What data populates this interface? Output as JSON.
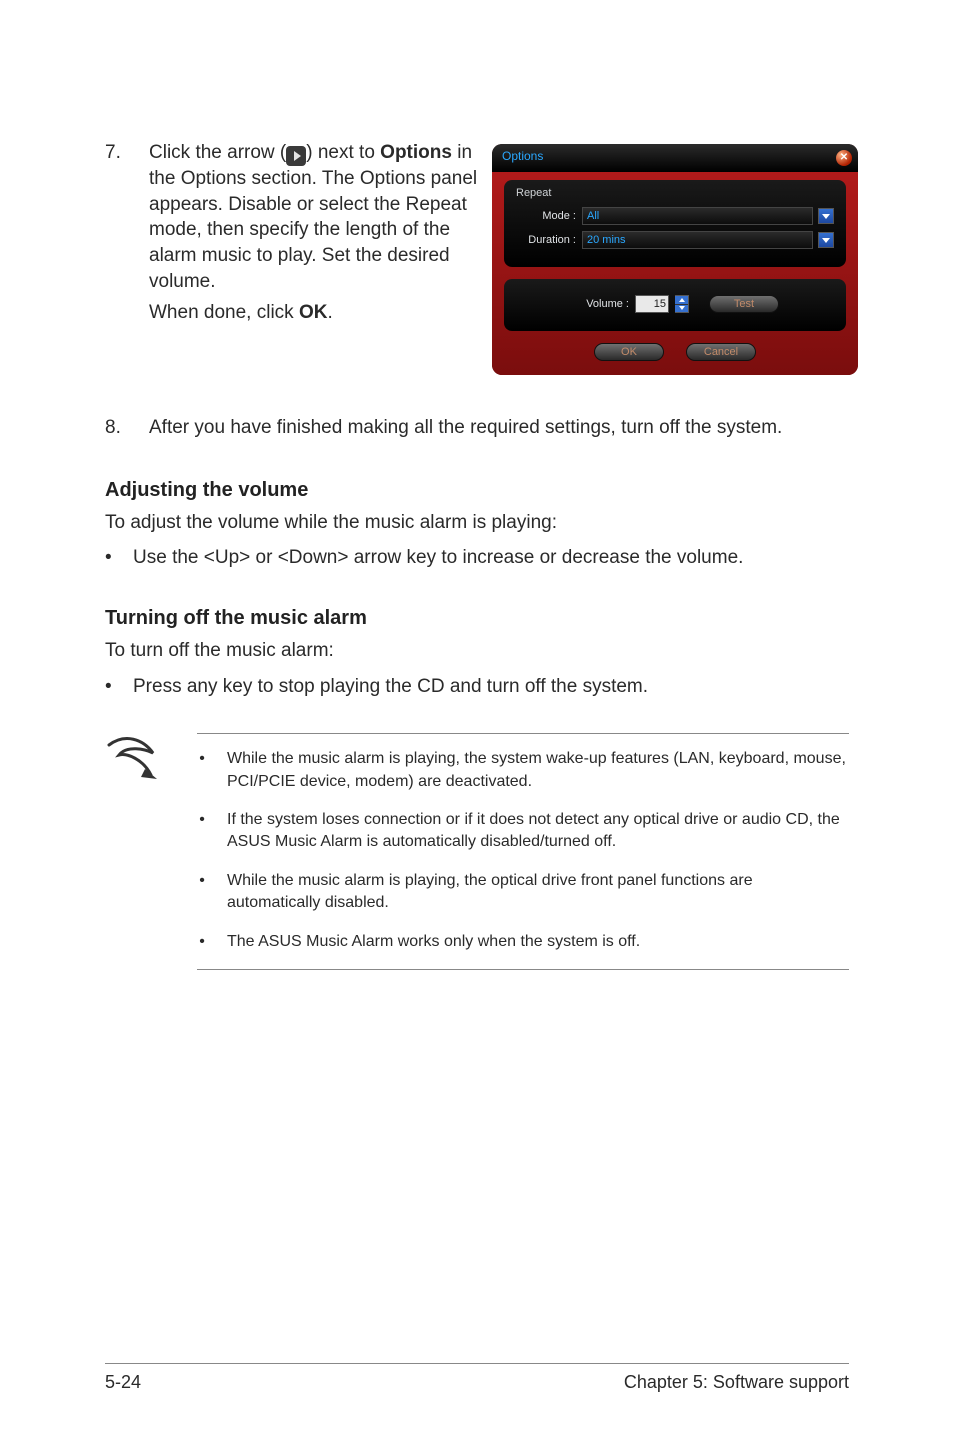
{
  "step7": {
    "number": "7.",
    "text_pre": "Click the arrow (",
    "text_mid": ") next to ",
    "bold1": "Options",
    "text_after": " in the Options section. The Options panel appears. Disable or select the Repeat mode, then specify the length of the alarm music to play. Set the desired volume.",
    "extra_pre": "When done, click ",
    "bold2": "OK",
    "extra_post": "."
  },
  "dialog": {
    "title": "Options",
    "legend": "Repeat",
    "mode_label": "Mode :",
    "mode_value": "All",
    "duration_label": "Duration :",
    "duration_value": "20 mins",
    "volume_label": "Volume :",
    "volume_value": "15",
    "test": "Test",
    "ok": "OK",
    "cancel": "Cancel"
  },
  "step8": {
    "number": "8.",
    "text": "After you have finished making all the required settings, turn off the system."
  },
  "adjust": {
    "heading": "Adjusting the volume",
    "para": "To adjust the volume while the music alarm is playing:",
    "bullet": "Use the  <Up> or <Down> arrow key to increase or decrease the volume."
  },
  "turnoff": {
    "heading": "Turning off the music alarm",
    "para": "To turn off the music alarm:",
    "bullet": "Press any key to stop playing the CD and turn off the system."
  },
  "notes": [
    "While the music alarm is playing, the system wake-up features (LAN, keyboard, mouse, PCI/PCIE device, modem) are deactivated.",
    "If the system loses connection or if it does not detect any optical drive or audio CD, the ASUS Music Alarm is automatically disabled/turned off.",
    "While the music alarm is playing, the optical drive front panel functions are automatically disabled.",
    "The ASUS Music Alarm works only when the system is off."
  ],
  "footer": {
    "left": "5-24",
    "right": "Chapter 5: Software support"
  }
}
